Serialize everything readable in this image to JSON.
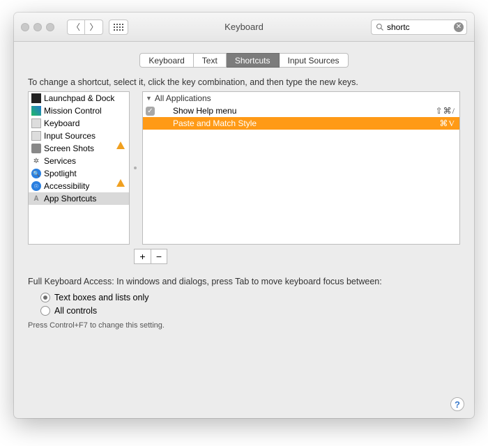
{
  "window_title": "Keyboard",
  "search": {
    "value": "shortc"
  },
  "tabs": [
    {
      "label": "Keyboard",
      "selected": false
    },
    {
      "label": "Text",
      "selected": false
    },
    {
      "label": "Shortcuts",
      "selected": true
    },
    {
      "label": "Input Sources",
      "selected": false
    }
  ],
  "instructions": "To change a shortcut, select it, click the key combination, and then type the new keys.",
  "categories": [
    {
      "label": "Launchpad & Dock",
      "icon": "launchpad",
      "warn": false,
      "selected": false
    },
    {
      "label": "Mission Control",
      "icon": "mission",
      "warn": false,
      "selected": false
    },
    {
      "label": "Keyboard",
      "icon": "keyboard",
      "warn": false,
      "selected": false
    },
    {
      "label": "Input Sources",
      "icon": "input",
      "warn": true,
      "selected": false
    },
    {
      "label": "Screen Shots",
      "icon": "screenshot",
      "warn": false,
      "selected": false
    },
    {
      "label": "Services",
      "icon": "services",
      "warn": false,
      "selected": false
    },
    {
      "label": "Spotlight",
      "icon": "spotlight",
      "warn": true,
      "selected": false
    },
    {
      "label": "Accessibility",
      "icon": "accessibility",
      "warn": false,
      "selected": false
    },
    {
      "label": "App Shortcuts",
      "icon": "app",
      "warn": false,
      "selected": true
    }
  ],
  "group_header": "All Applications",
  "shortcuts": [
    {
      "label": "Show Help menu",
      "keys": "⇧⌘/",
      "checked": true,
      "selected": false
    },
    {
      "label": "Paste and Match Style",
      "keys": "⌘V",
      "checked": true,
      "selected": true
    }
  ],
  "access_label": "Full Keyboard Access: In windows and dialogs, press Tab to move keyboard focus between:",
  "radios": [
    {
      "label": "Text boxes and lists only",
      "checked": true
    },
    {
      "label": "All controls",
      "checked": false
    }
  ],
  "hint": "Press Control+F7 to change this setting.",
  "add_label": "+",
  "remove_label": "−",
  "help_label": "?"
}
